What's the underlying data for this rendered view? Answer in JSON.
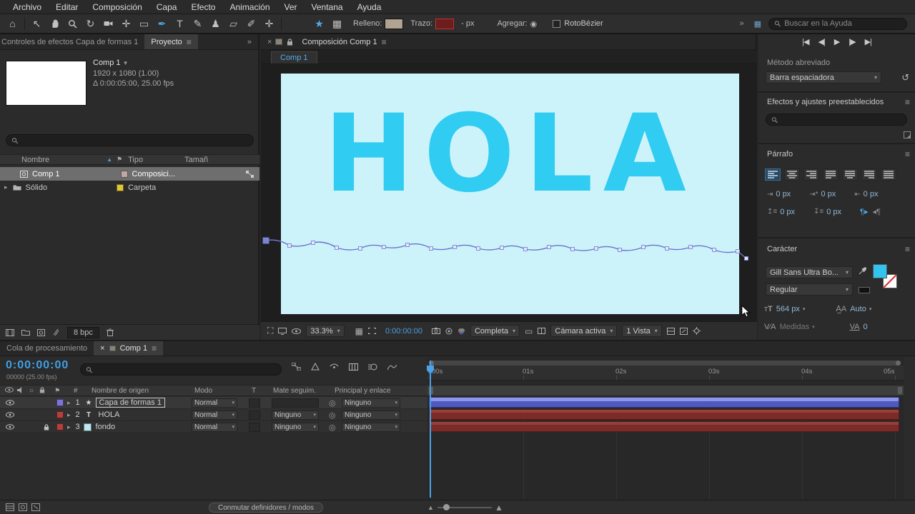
{
  "icons": {
    "menu": "≡",
    "chevrons": "»",
    "close": "×",
    "caret": "▾",
    "twirl": "▸",
    "sort_asc": "▲",
    "solo": "○",
    "pickwhip": "◎",
    "flag": "⚑",
    "home": "⌂",
    "selection": "↖",
    "rotate": "↻",
    "rect_tool": "▭",
    "pen": "✒",
    "type": "T",
    "brush": "✎",
    "stamp": "♟",
    "eraser": "▱",
    "rotobrush": "✐",
    "puppet": "✛",
    "star": "★",
    "grid": "▦",
    "reset": "↺",
    "go_first": "|◀",
    "prev_frame": "◀|",
    "play": "▶",
    "next_frame": "|▶",
    "go_last": "▶|"
  },
  "menubar": {
    "items": [
      "Archivo",
      "Editar",
      "Composición",
      "Capa",
      "Efecto",
      "Animación",
      "Ver",
      "Ventana",
      "Ayuda"
    ]
  },
  "toolbar": {
    "fill_label": "Relleno:",
    "stroke_label": "Trazo:",
    "stroke_width": "- px",
    "add_label": "Agregar:",
    "rotobezier_label": "RotoBézier",
    "help_search_placeholder": "Buscar en la Ayuda"
  },
  "project": {
    "tab_effect_controls": "Controles de efectos Capa de formas 1",
    "tab_project": "Proyecto",
    "comp_name": "Comp 1",
    "comp_resolution": "1920 x 1080 (1.00)",
    "comp_duration": "Δ 0:00:05:00, 25.00 fps",
    "col_name": "Nombre",
    "col_type": "Tipo",
    "col_size": "Tamañ",
    "items": [
      {
        "name": "Comp 1",
        "type": "Composici..."
      },
      {
        "name": "Sólido",
        "type": "Carpeta"
      }
    ],
    "bpc_label": "8 bpc"
  },
  "comp": {
    "tab_title": "Composición Comp 1",
    "viewer_tab": "Comp 1",
    "canvas_text": "HOLA",
    "zoom_value": "33.3%",
    "timecode": "0:00:00:00",
    "resolution_value": "Completa",
    "camera_value": "Cámara activa",
    "view_value": "1 Vista"
  },
  "rightbar": {
    "shortcut_label": "Método abreviado",
    "shortcut_value": "Barra espaciadora",
    "effects_title": "Efectos y ajustes preestablecidos",
    "paragraph": {
      "title": "Párrafo",
      "indent_left": "0 px",
      "indent_right": "0 px",
      "indent_first": "0 px",
      "space_before": "0 px",
      "space_after": "0 px"
    },
    "character": {
      "title": "Carácter",
      "font_family": "Gill Sans Ultra Bo...",
      "font_style": "Regular",
      "size_label": "564 px",
      "leading_value": "Auto",
      "kerning_value": "Medidas",
      "tracking_value": "0"
    }
  },
  "timeline": {
    "tab_render_queue": "Cola de procesamiento",
    "tab_comp": "Comp 1",
    "timecode": "0:00:00:00",
    "frame_info": "00000 (25.00 fps)",
    "col_hash": "#",
    "col_source_name": "Nombre de origen",
    "col_mode": "Modo",
    "col_t": "T",
    "col_matte": "Mate seguim.",
    "col_parent": "Principal y enlace",
    "ruler_labels": [
      "00s",
      "01s",
      "02s",
      "03s",
      "04s",
      "05s"
    ],
    "layers": [
      {
        "index": "1",
        "name": "Capa de formas 1",
        "mode": "Normal",
        "matte": "",
        "parent": "Ninguno"
      },
      {
        "index": "2",
        "name": "HOLA",
        "mode": "Normal",
        "matte": "Ninguno",
        "parent": "Ninguno"
      },
      {
        "index": "3",
        "name": "fondo",
        "mode": "Normal",
        "matte": "Ninguno",
        "parent": "Ninguno"
      }
    ],
    "footer_button": "Conmutar definidores / modos"
  },
  "colors": {
    "accent_blue": "#2f8ceb",
    "canvas_bg": "#cdf3fa",
    "canvas_text": "#30ccf1",
    "shape_bar": "#4e58c1",
    "red_bar": "#7c2b28"
  }
}
